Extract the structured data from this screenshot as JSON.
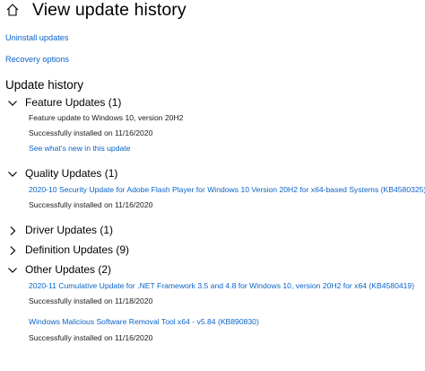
{
  "header": {
    "title": "View update history"
  },
  "links": {
    "uninstall": "Uninstall updates",
    "recovery": "Recovery options"
  },
  "history": {
    "title": "Update history"
  },
  "groups": {
    "feature": {
      "label": "Feature Updates (1)",
      "expanded": true,
      "items": [
        {
          "name": "Feature update to Windows 10, version 20H2",
          "status": "Successfully installed on 11/16/2020",
          "link": "See what's new in this update"
        }
      ]
    },
    "quality": {
      "label": "Quality Updates (1)",
      "expanded": true,
      "items": [
        {
          "name": "2020-10 Security Update for Adobe Flash Player for Windows 10 Version 20H2 for x64-based Systems (KB4580325)",
          "status": "Successfully installed on 11/16/2020"
        }
      ]
    },
    "driver": {
      "label": "Driver Updates (1)",
      "expanded": false
    },
    "definition": {
      "label": "Definition Updates (9)",
      "expanded": false
    },
    "other": {
      "label": "Other Updates (2)",
      "expanded": true,
      "items": [
        {
          "name": "2020-11 Cumulative Update for .NET Framework 3.5 and 4.8 for Windows 10, version 20H2 for x64 (KB4580419)",
          "status": "Successfully installed on 11/18/2020"
        },
        {
          "name": "Windows Malicious Software Removal Tool x64 - v5.84 (KB890830)",
          "status": "Successfully installed on 11/16/2020"
        }
      ]
    }
  },
  "colors": {
    "link": "#0a64c8",
    "text": "#000000",
    "background": "#ffffff"
  },
  "icons": {
    "home": "home-icon",
    "expanded": "chevron-down-icon",
    "collapsed": "chevron-right-icon"
  }
}
